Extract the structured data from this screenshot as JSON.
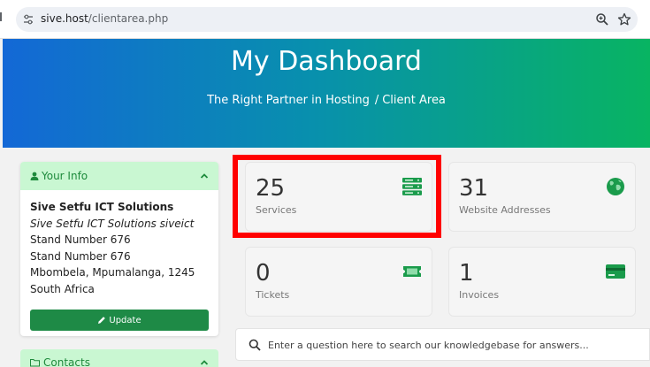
{
  "browser": {
    "url_host": "sive.host",
    "url_path": "/clientarea.php"
  },
  "hero": {
    "title": "My Dashboard",
    "breadcrumb": [
      "The Right Partner in Hosting",
      "Client Area"
    ],
    "separator": "/"
  },
  "your_info": {
    "title": "Your Info",
    "company": "Sive Setfu ICT Solutions",
    "alias": "Sive Setfu ICT Solutions siveict",
    "address1": "Stand Number 676",
    "address2": "Stand Number 676",
    "city_line": "Mbombela, Mpumalanga, 1245",
    "country": "South Africa",
    "update_label": "Update"
  },
  "contacts": {
    "title": "Contacts"
  },
  "tiles": [
    {
      "count": "25",
      "label": "Services",
      "icon": "server-icon"
    },
    {
      "count": "31",
      "label": "Website Addresses",
      "icon": "globe-icon"
    },
    {
      "count": "0",
      "label": "Tickets",
      "icon": "ticket-icon"
    },
    {
      "count": "1",
      "label": "Invoices",
      "icon": "credit-card-icon"
    }
  ],
  "kb": {
    "placeholder": "Enter a question here to search our knowledgebase for answers..."
  },
  "colors": {
    "accent": "#1e8a46",
    "highlight": "#ff0000",
    "panel_header": "#c9f7d2"
  }
}
